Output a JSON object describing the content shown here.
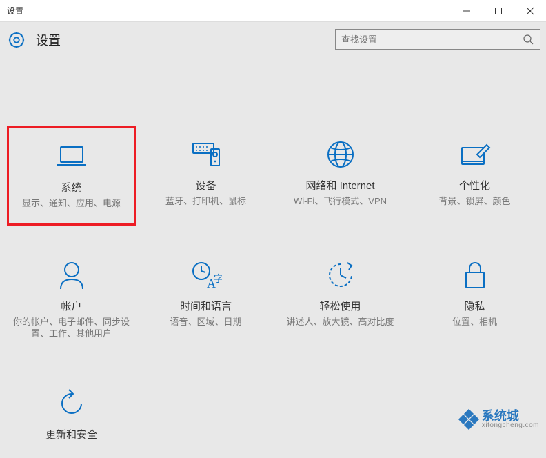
{
  "window": {
    "title": "设置",
    "header_title": "设置"
  },
  "search": {
    "placeholder": "查找设置"
  },
  "tiles": [
    {
      "title": "系统",
      "desc": "显示、通知、应用、电源"
    },
    {
      "title": "设备",
      "desc": "蓝牙、打印机、鼠标"
    },
    {
      "title": "网络和 Internet",
      "desc": "Wi-Fi、飞行模式、VPN"
    },
    {
      "title": "个性化",
      "desc": "背景、锁屏、颜色"
    },
    {
      "title": "帐户",
      "desc": "你的帐户、电子邮件、同步设置、工作、其他用户"
    },
    {
      "title": "时间和语言",
      "desc": "语音、区域、日期"
    },
    {
      "title": "轻松使用",
      "desc": "讲述人、放大镜、高对比度"
    },
    {
      "title": "隐私",
      "desc": "位置、相机"
    },
    {
      "title": "更新和安全",
      "desc": ""
    }
  ],
  "watermark": {
    "text": "系统城",
    "sub": "xitongcheng.com"
  }
}
